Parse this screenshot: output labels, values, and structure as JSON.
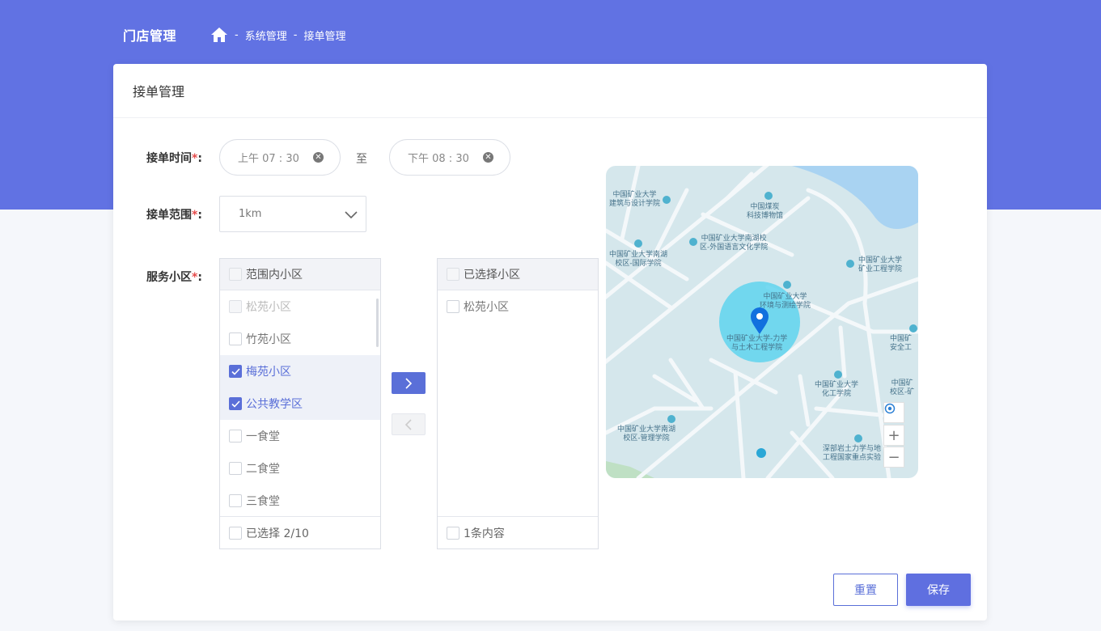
{
  "header": {
    "brand": "门店管理",
    "breadcrumb": [
      "系统管理",
      "接单管理"
    ],
    "separator": "-"
  },
  "card": {
    "title": "接单管理"
  },
  "form": {
    "time": {
      "label": "接单时间",
      "required_mark": "*",
      "colon": ":",
      "start": "上午  07 : 30",
      "to": "至",
      "end": "下午  08 : 30"
    },
    "range": {
      "label": "接单范围",
      "required_mark": "*",
      "colon": ":",
      "value": "1km"
    },
    "community": {
      "label": "服务小区",
      "required_mark": "*",
      "colon": ":"
    }
  },
  "transfer": {
    "left": {
      "title": "范围内小区",
      "items": [
        {
          "label": "松苑小区",
          "state": "disabled"
        },
        {
          "label": "竹苑小区",
          "state": "unchecked"
        },
        {
          "label": "梅苑小区",
          "state": "checked"
        },
        {
          "label": "公共教学区",
          "state": "checked"
        },
        {
          "label": "一食堂",
          "state": "unchecked"
        },
        {
          "label": "二食堂",
          "state": "unchecked"
        },
        {
          "label": "三食堂",
          "state": "unchecked"
        }
      ],
      "footer": "已选择 2/10"
    },
    "right": {
      "title": "已选择小区",
      "items": [
        {
          "label": "松苑小区",
          "state": "unchecked"
        }
      ],
      "footer": "1条内容"
    }
  },
  "map": {
    "labels": [
      "中国矿业大学\n建筑与设计学院",
      "中国煤炭\n科技博物馆",
      "中国矿业大学南湖校\n区-外国语言文化学院",
      "中国矿业大学南湖\n校区-国际学院",
      "中国矿业大学\n矿业工程学院",
      "中国矿业大学\n环境与测绘学院",
      "中国矿业大学-力学\n与土木工程学院",
      "中国矿\n安全工",
      "中国矿业大学\n化工学院",
      "中国矿\n校区-矿",
      "中国矿业大学南湖\n校区-管理学院",
      "深部岩土力学与地\n工程国家重点实验"
    ],
    "controls": {
      "zoom_in": "+",
      "zoom_out": "−"
    }
  },
  "actions": {
    "reset": "重置",
    "save": "保存"
  },
  "colors": {
    "primary": "#6172e3",
    "required": "#e54b4b",
    "map_bg": "#d5e7ec",
    "circle": "#5fd3ee"
  }
}
